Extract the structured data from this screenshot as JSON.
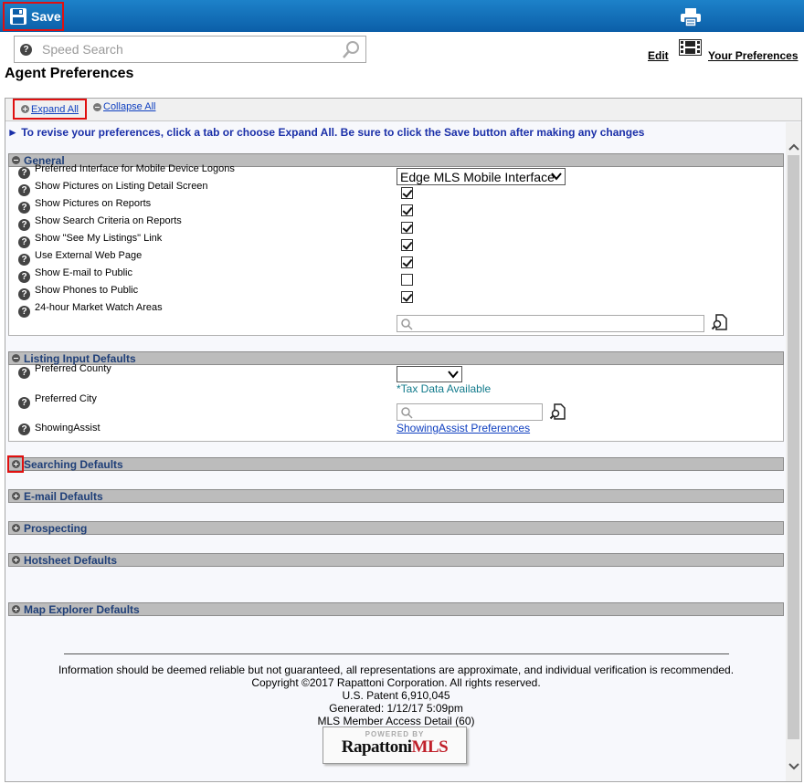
{
  "toolbar": {
    "save_label": "Save"
  },
  "search": {
    "placeholder": "Speed Search"
  },
  "header_links": {
    "edit": "Edit",
    "your_preferences": "Your Preferences"
  },
  "page": {
    "title": "Agent Preferences",
    "expand_all": "Expand All",
    "collapse_all": "Collapse All",
    "instructions": "► To revise your preferences, click a tab or choose Expand All. Be sure to click the Save button after making any changes"
  },
  "general": {
    "title": "General",
    "rows": [
      {
        "label": "Preferred Interface for Mobile Device Logons"
      },
      {
        "label": "Show Pictures on Listing Detail Screen",
        "checked": true
      },
      {
        "label": "Show Pictures on Reports",
        "checked": true
      },
      {
        "label": "Show Search Criteria on Reports",
        "checked": true
      },
      {
        "label": "Show \"See My Listings\" Link",
        "checked": true
      },
      {
        "label": "Use External Web Page",
        "checked": true
      },
      {
        "label": "Show E-mail to Public",
        "checked": false
      },
      {
        "label": "Show Phones to Public",
        "checked": true
      },
      {
        "label": "24-hour Market Watch Areas"
      }
    ],
    "mobile_interface_value": "Edge MLS Mobile Interface"
  },
  "listing_input": {
    "title": "Listing Input Defaults",
    "county_label": "Preferred County",
    "county_value": "",
    "tax_note": "*Tax Data Available",
    "city_label": "Preferred City",
    "showing_label": "ShowingAssist",
    "showing_link": "ShowingAssist Preferences"
  },
  "sections": {
    "searching": "Searching Defaults",
    "email": "E-mail Defaults",
    "prospecting": "Prospecting",
    "hotsheet": "Hotsheet Defaults",
    "map": "Map Explorer Defaults"
  },
  "footer": {
    "line1": "Information should be deemed reliable but not guaranteed, all representations are approximate, and individual verification is recommended.",
    "line2": "Copyright ©2017 Rapattoni Corporation. All rights reserved.",
    "line3": "U.S. Patent 6,910,045",
    "line4": "Generated: 1/12/17 5:09pm",
    "line5": "MLS Member Access Detail (60)",
    "logo_top": "POWERED BY",
    "logo_main_1": "Rapattoni",
    "logo_main_2": "MLS"
  },
  "colors": {
    "topbar": "#0b5ea8",
    "highlight": "#e01010",
    "section_header_bg": "#bcbcbc",
    "section_title_text": "#1f3f78",
    "link": "#1040c0"
  }
}
